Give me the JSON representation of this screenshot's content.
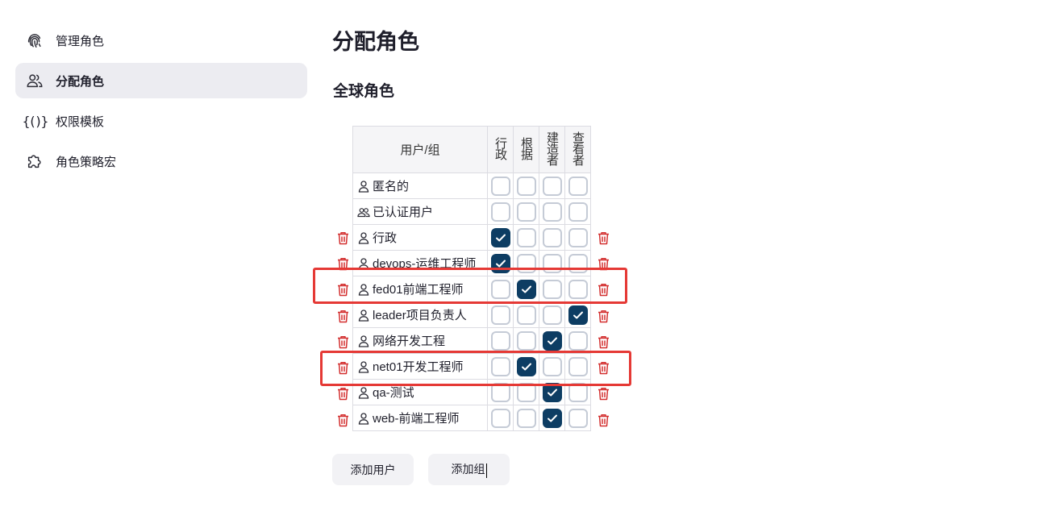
{
  "sidebar": {
    "items": [
      {
        "label": "管理角色",
        "icon": "fingerprint-icon",
        "active": false
      },
      {
        "label": "分配角色",
        "icon": "users-icon",
        "active": true
      },
      {
        "label": "权限模板",
        "icon": "braces-icon",
        "active": false
      },
      {
        "label": "角色策略宏",
        "icon": "puzzle-icon",
        "active": false
      }
    ]
  },
  "main": {
    "title": "分配角色",
    "section_title": "全球角色",
    "table": {
      "user_column_header": "用户/组",
      "role_headers": [
        "行政",
        "根据",
        "建造者",
        "查看者"
      ],
      "rows": [
        {
          "name": "匿名的",
          "icon": "user-icon",
          "deletable": false,
          "checks": [
            false,
            false,
            false,
            false
          ]
        },
        {
          "name": "已认证用户",
          "icon": "users-icon",
          "deletable": false,
          "checks": [
            false,
            false,
            false,
            false
          ]
        },
        {
          "name": "行政",
          "icon": "user-icon",
          "deletable": true,
          "checks": [
            true,
            false,
            false,
            false
          ]
        },
        {
          "name": "devops-运维工程师",
          "icon": "user-icon",
          "deletable": true,
          "checks": [
            true,
            false,
            false,
            false
          ]
        },
        {
          "name": "fed01前端工程师",
          "icon": "user-icon",
          "deletable": true,
          "checks": [
            false,
            true,
            false,
            false
          ]
        },
        {
          "name": "leader项目负责人",
          "icon": "user-icon",
          "deletable": true,
          "checks": [
            false,
            false,
            false,
            true
          ]
        },
        {
          "name": "网络开发工程",
          "icon": "user-icon",
          "deletable": true,
          "checks": [
            false,
            false,
            true,
            false
          ]
        },
        {
          "name": "net01开发工程师",
          "icon": "user-icon",
          "deletable": true,
          "checks": [
            false,
            true,
            false,
            false
          ]
        },
        {
          "name": "qa-测试",
          "icon": "user-icon",
          "deletable": true,
          "checks": [
            false,
            false,
            true,
            false
          ]
        },
        {
          "name": "web-前端工程师",
          "icon": "user-icon",
          "deletable": true,
          "checks": [
            false,
            false,
            true,
            false
          ]
        }
      ]
    },
    "buttons": {
      "add_user": "添加用户",
      "add_group": "添加组"
    }
  },
  "colors": {
    "accent": "#0d3d63",
    "delete": "#d32f2f",
    "highlight": "#e53935",
    "active_nav": "#ececf1"
  }
}
